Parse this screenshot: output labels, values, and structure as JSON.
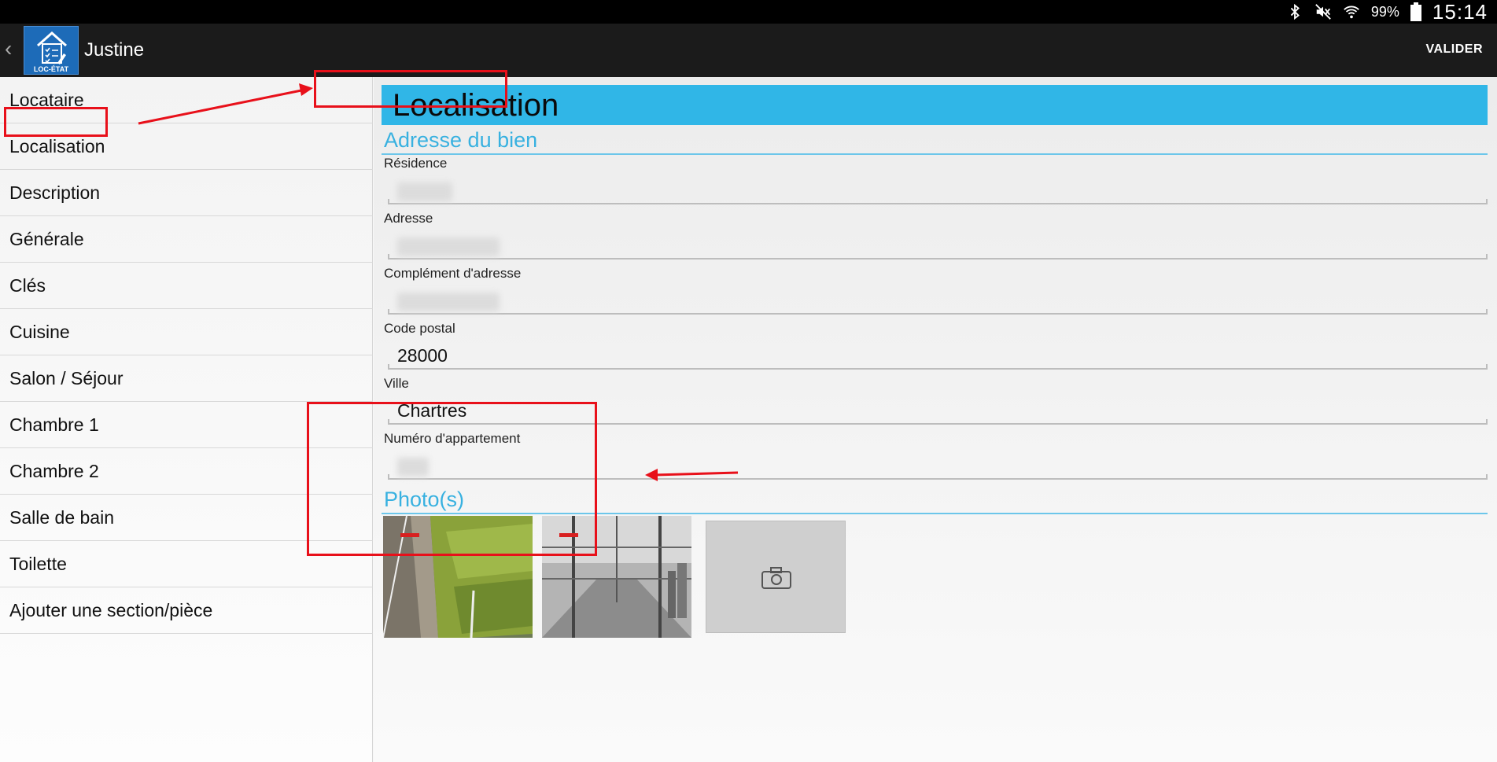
{
  "status_bar": {
    "battery": "99%",
    "time": "15:14"
  },
  "action_bar": {
    "title": "Justine",
    "logo_text": "LOC-ÉTAT",
    "validate_label": "VALIDER"
  },
  "sidebar": {
    "items": [
      {
        "label": "Locataire"
      },
      {
        "label": "Localisation"
      },
      {
        "label": "Description"
      },
      {
        "label": "Générale"
      },
      {
        "label": "Clés"
      },
      {
        "label": "Cuisine"
      },
      {
        "label": "Salon / Séjour"
      },
      {
        "label": "Chambre 1"
      },
      {
        "label": "Chambre 2"
      },
      {
        "label": "Salle de bain"
      },
      {
        "label": "Toilette"
      },
      {
        "label": "Ajouter une section/pièce"
      }
    ]
  },
  "main": {
    "section_title": "Localisation",
    "address_header": "Adresse du bien",
    "fields": [
      {
        "label": "Résidence",
        "value": ""
      },
      {
        "label": "Adresse",
        "value": ""
      },
      {
        "label": "Complément d'adresse",
        "value": ""
      },
      {
        "label": "Code postal",
        "value": "28000"
      },
      {
        "label": "Ville",
        "value": "Chartres"
      },
      {
        "label": "Numéro d'appartement",
        "value": ""
      }
    ],
    "photos_header": "Photo(s)"
  },
  "colors": {
    "accent": "#30b6e7",
    "annotation": "#e8101a"
  }
}
